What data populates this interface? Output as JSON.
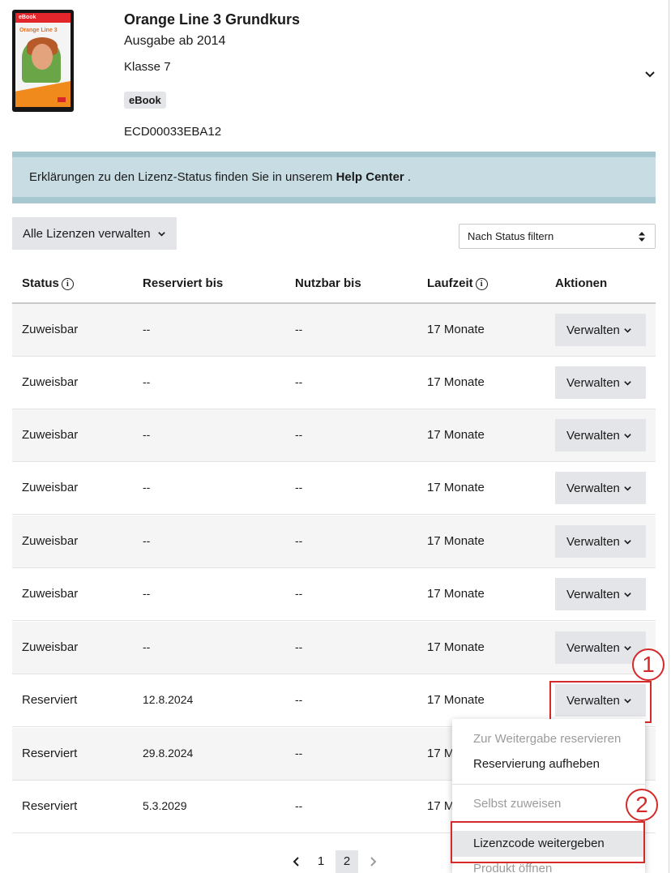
{
  "product": {
    "cover_band_text": "eBook",
    "cover_title": "Orange Line 3",
    "title": "Orange Line 3 Grundkurs",
    "edition": "Ausgabe ab 2014",
    "class": "Klasse 7",
    "badge": "eBook",
    "code": "ECD00033EBA12"
  },
  "banner": {
    "text": "Erklärungen zu den Lizenz-Status finden Sie in unserem ",
    "link": "Help Center",
    "suffix": " ."
  },
  "controls": {
    "manage_all_label": "Alle Lizenzen verwalten",
    "filter_placeholder": "Nach Status filtern"
  },
  "table": {
    "headers": {
      "status": "Status",
      "reserved_until": "Reserviert bis",
      "usable_until": "Nutzbar bis",
      "duration": "Laufzeit",
      "actions": "Aktionen"
    },
    "info_glyph": "i",
    "action_label": "Verwalten",
    "rows": [
      {
        "status": "Zuweisbar",
        "reserved_until": "--",
        "usable_until": "--",
        "duration": "17 Monate"
      },
      {
        "status": "Zuweisbar",
        "reserved_until": "--",
        "usable_until": "--",
        "duration": "17 Monate"
      },
      {
        "status": "Zuweisbar",
        "reserved_until": "--",
        "usable_until": "--",
        "duration": "17 Monate"
      },
      {
        "status": "Zuweisbar",
        "reserved_until": "--",
        "usable_until": "--",
        "duration": "17 Monate"
      },
      {
        "status": "Zuweisbar",
        "reserved_until": "--",
        "usable_until": "--",
        "duration": "17 Monate"
      },
      {
        "status": "Zuweisbar",
        "reserved_until": "--",
        "usable_until": "--",
        "duration": "17 Monate"
      },
      {
        "status": "Zuweisbar",
        "reserved_until": "--",
        "usable_until": "--",
        "duration": "17 Monate"
      },
      {
        "status": "Reserviert",
        "reserved_until": "12.8.2024",
        "usable_until": "--",
        "duration": "17 Monate"
      },
      {
        "status": "Reserviert",
        "reserved_until": "29.8.2024",
        "usable_until": "--",
        "duration": "17 M"
      },
      {
        "status": "Reserviert",
        "reserved_until": "5.3.2029",
        "usable_until": "--",
        "duration": "17 M"
      }
    ]
  },
  "dropdown": {
    "items": [
      {
        "label": "Zur Weitergabe reservieren",
        "disabled": true
      },
      {
        "label": "Reservierung aufheben",
        "disabled": false
      },
      {
        "label": "Selbst zuweisen",
        "disabled": true
      },
      {
        "label": "Lizenzcode weitergeben",
        "disabled": false,
        "highlighted": true
      },
      {
        "label": "Produkt öffnen",
        "disabled": true
      }
    ]
  },
  "annotations": {
    "step1": "1",
    "step2": "2",
    "color": "#d42a2a"
  },
  "pagination": {
    "pages": [
      "1",
      "2"
    ],
    "current": "2"
  },
  "icons": {
    "expand": "chevron-down-icon",
    "dropdown": "chevron-down-icon",
    "info": "info-circle-icon",
    "prev": "chevron-left-icon",
    "next": "chevron-right-icon",
    "sort": "up-down-arrows-icon"
  }
}
